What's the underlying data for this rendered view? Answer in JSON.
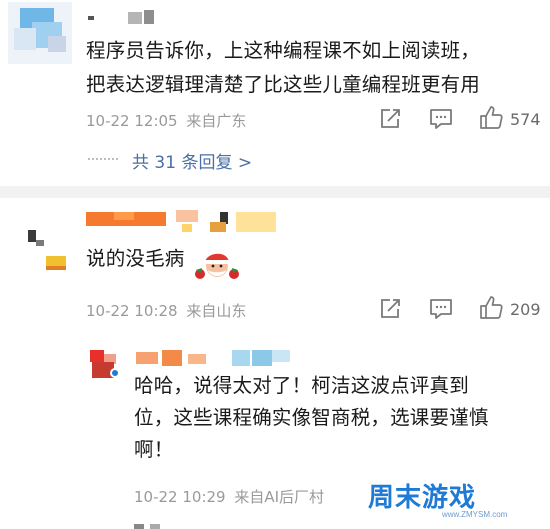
{
  "comment1": {
    "text_lines": [
      "程序员告诉你，上这种编程课不如上阅读班，",
      "把表达逻辑理清楚了比这些儿童编程班更有用"
    ],
    "time": "10-22 12:05",
    "source": "来自广东",
    "like_count": "574",
    "replies_link": "共 31 条回复 >"
  },
  "comment2": {
    "text": "说的没毛病",
    "time": "10-22 10:28",
    "source": "来自山东",
    "like_count": "209"
  },
  "reply": {
    "text_lines": [
      "哈哈，说得太对了！柯洁这波点评真到",
      "位，这些课程确实像智商税，选课要谨慎",
      "啊！"
    ],
    "time": "10-22 10:29",
    "source": "来自AI后厂村"
  },
  "watermark": {
    "brand": "周末游戏",
    "site": "www.ZMYSM.com"
  },
  "colors": {
    "link": "#4a6fa5",
    "meta": "#9a9a9a",
    "brand_blue": "#1f7ad6"
  }
}
